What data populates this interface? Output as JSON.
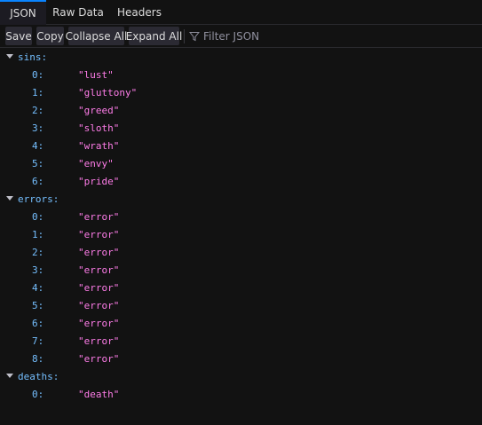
{
  "tabs": [
    {
      "label": "JSON"
    },
    {
      "label": "Raw Data"
    },
    {
      "label": "Headers"
    }
  ],
  "toolbar": {
    "save_label": "Save",
    "copy_label": "Copy",
    "collapse_label": "Collapse All",
    "expand_label": "Expand All",
    "filter_placeholder": "Filter JSON"
  },
  "colors": {
    "accent": "#0a84ff",
    "key": "#75bfff",
    "string": "#ff7de9",
    "background": "#121212"
  },
  "tree": {
    "sins": {
      "key": "sins:",
      "items": [
        {
          "index": "0:",
          "value": "\"lust\""
        },
        {
          "index": "1:",
          "value": "\"gluttony\""
        },
        {
          "index": "2:",
          "value": "\"greed\""
        },
        {
          "index": "3:",
          "value": "\"sloth\""
        },
        {
          "index": "4:",
          "value": "\"wrath\""
        },
        {
          "index": "5:",
          "value": "\"envy\""
        },
        {
          "index": "6:",
          "value": "\"pride\""
        }
      ]
    },
    "errors": {
      "key": "errors:",
      "items": [
        {
          "index": "0:",
          "value": "\"error\""
        },
        {
          "index": "1:",
          "value": "\"error\""
        },
        {
          "index": "2:",
          "value": "\"error\""
        },
        {
          "index": "3:",
          "value": "\"error\""
        },
        {
          "index": "4:",
          "value": "\"error\""
        },
        {
          "index": "5:",
          "value": "\"error\""
        },
        {
          "index": "6:",
          "value": "\"error\""
        },
        {
          "index": "7:",
          "value": "\"error\""
        },
        {
          "index": "8:",
          "value": "\"error\""
        }
      ]
    },
    "deaths": {
      "key": "deaths:",
      "items": [
        {
          "index": "0:",
          "value": "\"death\""
        }
      ]
    }
  }
}
